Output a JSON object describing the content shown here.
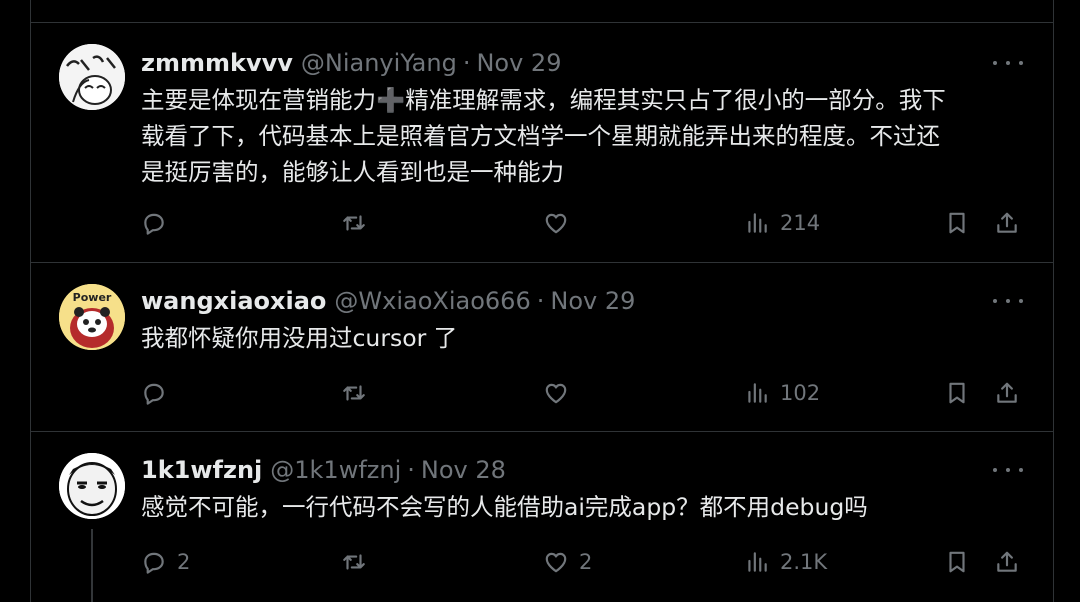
{
  "tweets": [
    {
      "name": "zmmmkvvv",
      "handle": "@NianyiYang",
      "dot": "·",
      "date": "Nov 29",
      "text": "主要是体现在营销能力➕精准理解需求，编程其实只占了很小的一部分。我下\n载看了下，代码基本上是照着官方文档学一个星期就能弄出来的程度。不过还\n是挺厉害的，能够让人看到也是一种能力",
      "replies": "",
      "retweets": "",
      "likes": "",
      "views": "214"
    },
    {
      "name": "wangxiaoxiao",
      "handle": "@WxiaoXiao666",
      "dot": "·",
      "date": "Nov 29",
      "avatar_text": "Power",
      "text": "我都怀疑你用没用过cursor 了",
      "replies": "",
      "retweets": "",
      "likes": "",
      "views": "102"
    },
    {
      "name": "1k1wfznj",
      "handle": "@1k1wfznj",
      "dot": "·",
      "date": "Nov 28",
      "text": "感觉不可能，一行代码不会写的人能借助ai完成app？都不用debug吗",
      "replies": "2",
      "retweets": "",
      "likes": "2",
      "views": "2.1K"
    }
  ],
  "icons": [
    "reply-icon",
    "retweet-icon",
    "like-icon",
    "views-icon",
    "bookmark-icon",
    "share-icon",
    "more-icon"
  ],
  "colors": {
    "background": "#000000",
    "text": "#e7e9ea",
    "muted": "#71767b",
    "border": "#2f3336"
  }
}
